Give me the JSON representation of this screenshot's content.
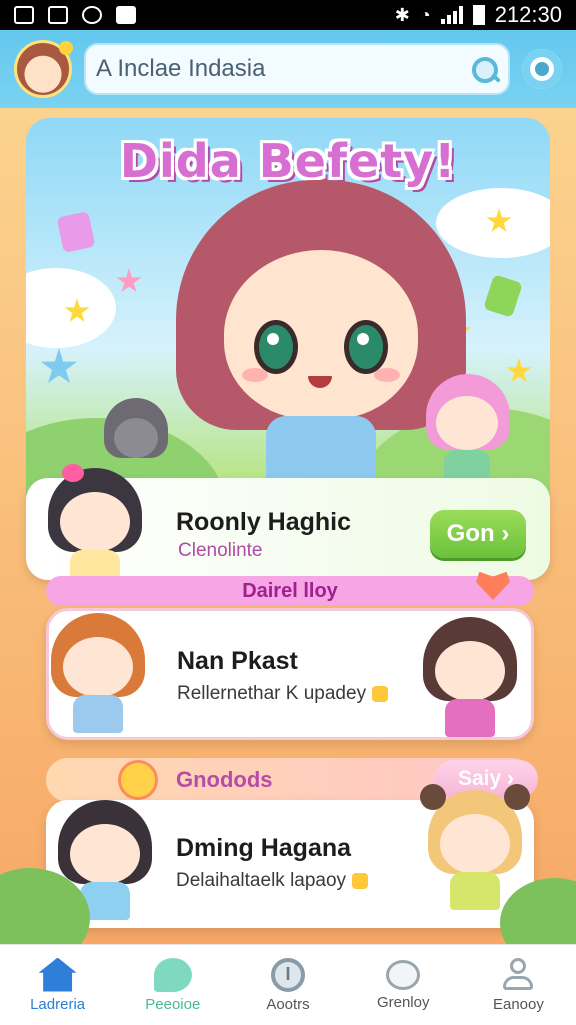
{
  "status_bar": {
    "time": "212:30"
  },
  "header": {
    "search_placeholder": "A Inclae Indasia"
  },
  "hero": {
    "title": "Dida Befety!"
  },
  "cards": [
    {
      "title": "Roonly Haghic",
      "subtitle": "Clenolinte",
      "button": "Gon ›"
    },
    {
      "banner": "Dairel lloy",
      "title": "Nan Pkast",
      "subtitle": "Rellernethar K upadey"
    },
    {
      "banner": "Gnodods",
      "button": "Saiy ›",
      "title": "Dming Hagana",
      "subtitle": "Delaihaltaelk lapaoy"
    }
  ],
  "nav": [
    {
      "label": "Ladreria",
      "icon": "home-icon",
      "active": true
    },
    {
      "label": "Peeoioe",
      "icon": "leaf-icon",
      "active": false
    },
    {
      "label": "Aootrs",
      "icon": "info-icon",
      "active": false
    },
    {
      "label": "Grenloy",
      "icon": "chat-icon",
      "active": false
    },
    {
      "label": "Eanooy",
      "icon": "user-icon",
      "active": false
    }
  ],
  "colors": {
    "header": "#63c7ee",
    "accent_green": "#6cc13a",
    "accent_pink": "#d76fd3",
    "nav_active": "#2a7fd4"
  }
}
